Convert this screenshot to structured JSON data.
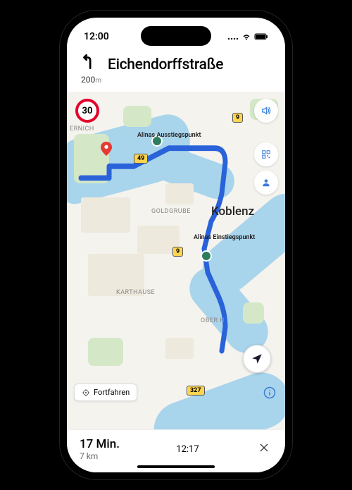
{
  "status": {
    "time": "12:00"
  },
  "nav": {
    "street": "Eichendorffstraße",
    "distance_value": "200",
    "distance_unit": "m"
  },
  "speed_limit": "30",
  "map": {
    "city": "Koblenz",
    "areas": {
      "ernich": "ERNICH",
      "goldgrube": "GOLDGRUBE",
      "karthause": "KARTHAUSE",
      "ober": "OBER     H"
    },
    "shields": {
      "r9a": "9",
      "r49": "49",
      "r9b": "9",
      "r327": "327"
    },
    "poi": {
      "einstieg": "Alinas Einstiegspunkt",
      "ausstieg": "Alinas Ausstiegspunkt"
    }
  },
  "continue_label": "Fortfahren",
  "trip": {
    "duration": "17 Min.",
    "distance": "7 km",
    "arrival": "12:17"
  }
}
